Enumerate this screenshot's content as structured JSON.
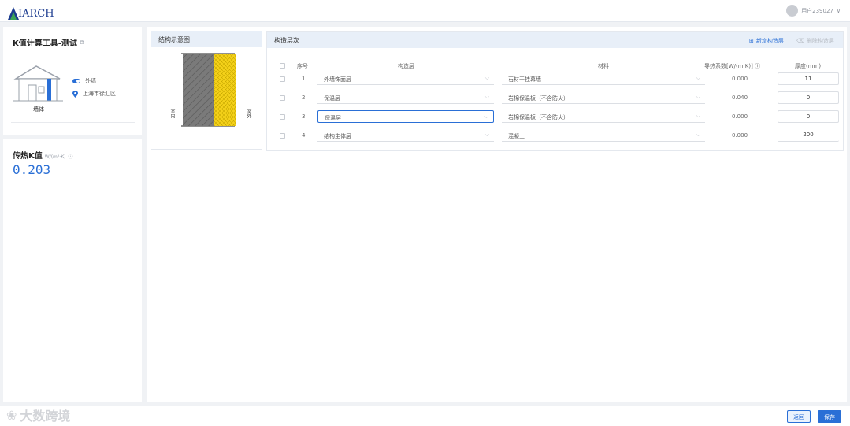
{
  "header": {
    "logo_text": "IARCH",
    "user_name": "用户239027",
    "user_chevron": "∨"
  },
  "tool": {
    "title": "K值计算工具-测试",
    "house_label": "墙体",
    "attr_1": "外墙",
    "attr_2": "上海市徐汇区"
  },
  "k_panel": {
    "title": "传热K值",
    "unit": "W/(m²·K)",
    "value": "0.203"
  },
  "diagram": {
    "title": "结构示意图",
    "left_label": "室内",
    "right_label": "室外"
  },
  "structure": {
    "title": "构造层次",
    "add_label": "新增构造层",
    "delete_label": "删除构造层",
    "columns": {
      "index": "序号",
      "layer": "构造层",
      "material": "材料",
      "conductivity": "导热系数[W/(m·K)]",
      "thickness": "厚度(mm)"
    },
    "rows": [
      {
        "index": "1",
        "layer": "外墙饰面层",
        "material": "石材干挂幕墙",
        "k": "0.000",
        "thickness": "11"
      },
      {
        "index": "2",
        "layer": "保温层",
        "material": "岩棉保温板（不含防火）",
        "k": "0.040",
        "thickness": "0"
      },
      {
        "index": "3",
        "layer": "保温层",
        "material": "岩棉保温板（不含防火）",
        "k": "0.000",
        "thickness": "0"
      },
      {
        "index": "4",
        "layer": "结构主体层",
        "material": "混凝土",
        "k": "0.000",
        "thickness": "200"
      }
    ]
  },
  "footer": {
    "watermark": "大数跨境",
    "back_label": "返回",
    "save_label": "保存"
  },
  "colors": {
    "accent": "#2a6fd6",
    "insulation": "#f5d21a",
    "structure": "#7a7a7a",
    "panel_header": "#e8eff8"
  }
}
